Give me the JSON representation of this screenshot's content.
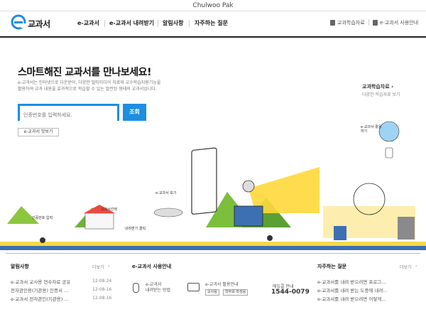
{
  "window": {
    "title": "Chulwoo Pak"
  },
  "header": {
    "logo_text": "교과서",
    "nav": [
      "e-교과서",
      "e-교과서 내려받기",
      "알림사항",
      "자주하는 질문"
    ],
    "util": [
      "교과학습자료",
      "e-교과서 사용안내"
    ]
  },
  "hero": {
    "title": "스마트해진 교과서를 만나보세요!",
    "desc1": "e-교과서는 인터넷으로 다운받아, 다양한 멀티미디어 자료와 교수학습지원기능을",
    "desc2": "활용하여 교과 내용을 효과적으로 학습할 수 있는 발전된 형태의 교과서입니다.",
    "search_placeholder": "인증번호를 입력하세요.",
    "search_button": "조회",
    "shortcut_button": "e-교과서 맛보기"
  },
  "side": {
    "link": "교과학습자료",
    "sub": "다양한 학습자료 보기"
  },
  "illus_labels": {
    "auth": "인증번호 입력",
    "school": "교과서선택",
    "download": "내려받기 클릭",
    "ebook_view": "e-교과서 보기",
    "ebook_use": "e-교과서 활용하기"
  },
  "notices": {
    "title": "알림사항",
    "more": "더보기",
    "items": [
      {
        "text": "e-교과서 교사용 연수자료 공유",
        "date": "12-08-24"
      },
      {
        "text": "전자관인용(기관용) 인증서 …",
        "date": "12-08-16"
      },
      {
        "text": "e-교과서 전자관인(기관용) …",
        "date": "12-08-16"
      }
    ]
  },
  "guide": {
    "title": "e-교과서 사용안내",
    "dl_line1": "e-교과서",
    "dl_line2": "내려받는 방법",
    "use_line1": "e-교과서 활용안내",
    "tag1": "교사용",
    "tag2": "학부모·학생용",
    "phone_label": "에듀콜 안내",
    "phone": "1544-0079"
  },
  "faq": {
    "title": "자주하는 질문",
    "more": "더보기",
    "items": [
      "e-교과서를 내려 받으려면 프로그…",
      "e-교과서를 내려 받는 도중에 내려…",
      "e-교과서를 내려 받으려면 어떻게…"
    ]
  },
  "colors": {
    "accent": "#1d8ee4",
    "yellow": "#ffd83b",
    "green": "#7bbf3c"
  }
}
